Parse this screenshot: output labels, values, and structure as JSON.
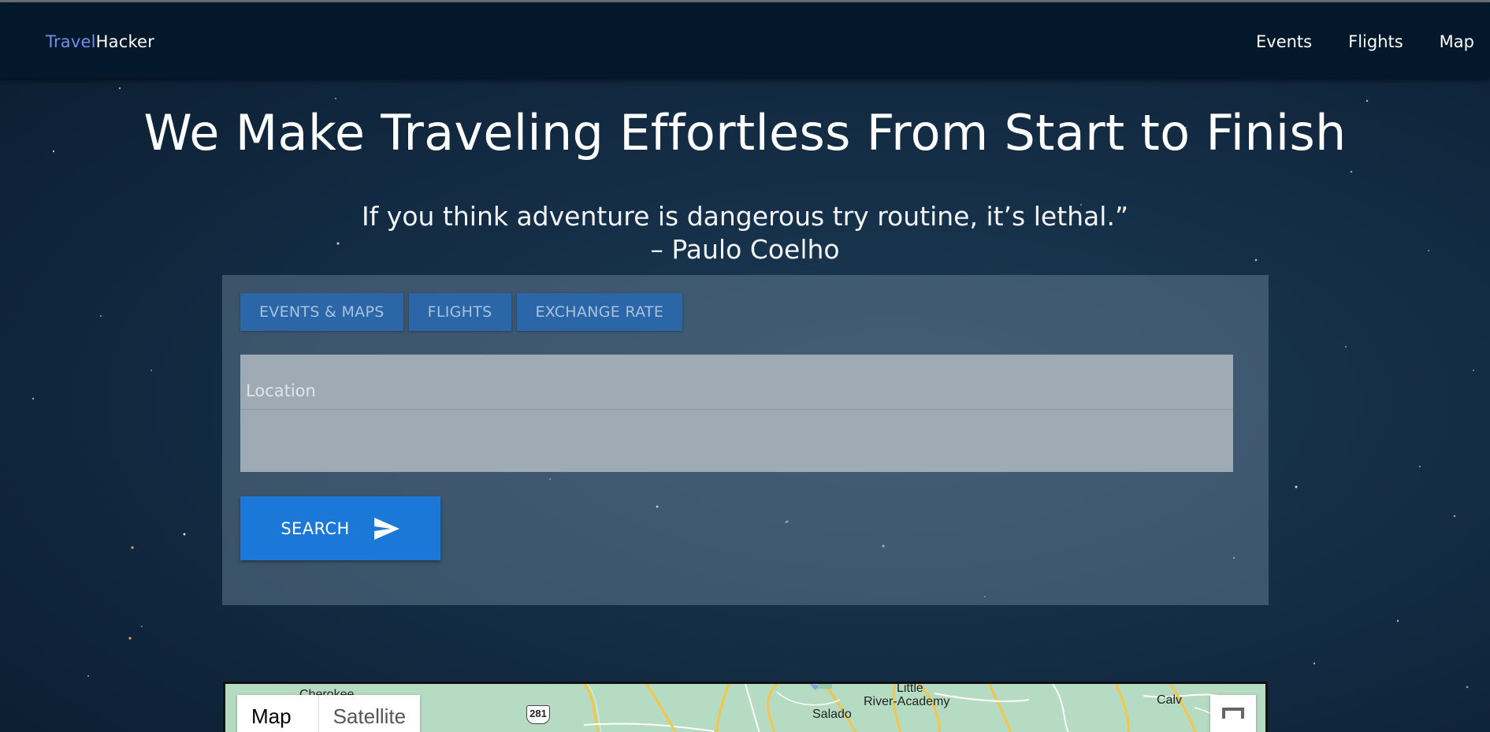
{
  "navbar": {
    "brand_part1": "Travel",
    "brand_part2": "Hacker",
    "links": [
      "Events",
      "Flights",
      "Map"
    ]
  },
  "hero": {
    "title": "We Make Traveling Effortless From Start to Finish",
    "quote_line1": "If you think adventure is dangerous try routine, it’s lethal.”",
    "quote_line2": "– Paulo Coelho"
  },
  "search_panel": {
    "tabs": [
      "EVENTS & MAPS",
      "FLIGHTS",
      "EXCHANGE RATE"
    ],
    "location_placeholder": "Location",
    "location_value": "",
    "search_label": "SEARCH",
    "search_icon": "send-icon"
  },
  "map": {
    "type_buttons": [
      "Map",
      "Satellite"
    ],
    "active_type": "Map",
    "labels": {
      "cherokee": "Cherokee",
      "little": "Little",
      "river_academy": "River-Academy",
      "salado": "Salado",
      "calvert": "Calv"
    },
    "highway_shield": "281",
    "fullscreen_icon": "fullscreen-icon"
  },
  "colors": {
    "navbar_bg": "#03182b",
    "brand_accent": "#6f8fe8",
    "tab_bg": "#2b67a8",
    "search_button": "#1b77d8",
    "map_land": "#b6dbc3"
  }
}
